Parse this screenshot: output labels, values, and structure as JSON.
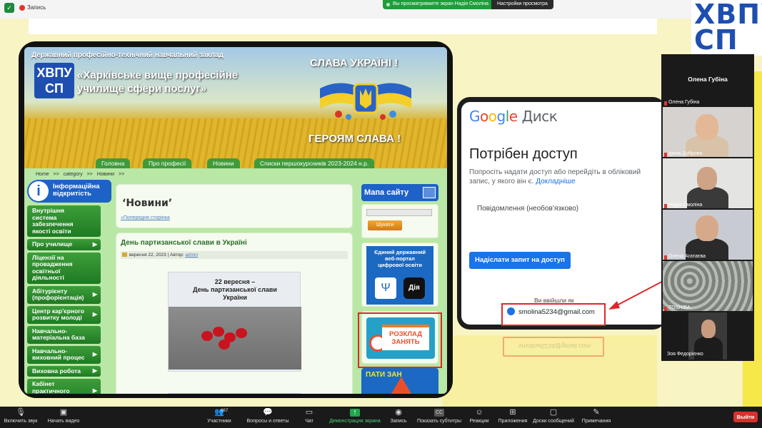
{
  "topbar": {
    "recording_label": "Запись",
    "share_notice": "Вы просматриваете экран Надія Смоліна",
    "view_options": "Настройки просмотра"
  },
  "corner_logo": "ХВПУ\nСП",
  "website": {
    "org_line": "Державний професійно-технічний навчальний заклад",
    "logo_text": "ХВПУ\nСП",
    "school_name": "«Харківське вище професійне\nучилище сфери послуг»",
    "glory_top": "СЛАВА УКРАЇНІ !",
    "glory_bottom": "ГЕРОЯМ СЛАВА !",
    "nav": [
      "Головна",
      "Про професії",
      "Новини",
      "Списки першокурсників 2023-2024 н.р."
    ],
    "breadcrumbs": [
      "Home",
      ">>",
      "category",
      ">>",
      "Новини",
      ">>"
    ],
    "info_box": "Інформаційна\nвідкритість",
    "menu": [
      {
        "label": "Внутрішня система забезпечення якості освіти",
        "arrow": ""
      },
      {
        "label": "Про училище",
        "arrow": "▶"
      },
      {
        "label": "Ліцензії на провадження освітньої діяльності",
        "arrow": ""
      },
      {
        "label": "Абітурієнту (профорієнтація)",
        "arrow": "▶"
      },
      {
        "label": "Центр кар'єрного розвитку молоді",
        "arrow": "▶"
      },
      {
        "label": "Навчально-матеріальна база",
        "arrow": ""
      },
      {
        "label": "Навчально-виховний процес",
        "arrow": "▶"
      },
      {
        "label": "Виховна робота",
        "arrow": "▶"
      },
      {
        "label": "Кабінет практичного психолога",
        "arrow": "▶"
      }
    ],
    "page_heading": "‘Новини’",
    "prev_page": "«Попередня сторінка",
    "post": {
      "title": "День партизанської слави в Україні",
      "date": "вересня 22, 2023",
      "author_prefix": " | Автор: ",
      "author": "admin",
      "image_caption": "22 вересня –\nДень партизанської слави\nУкраїни"
    },
    "sitemap": "Мапа сайту",
    "search_button": "Шукати",
    "portal": {
      "text": "Єдиний державний\nвеб-портал\nцифрової освіти",
      "diia": "Дія"
    },
    "schedule": "РОЗКЛАД\nЗАНЯТЬ",
    "warning_banner": "ПАТИ ЗАН"
  },
  "google_drive": {
    "logo_letters": [
      "G",
      "o",
      "o",
      "g",
      "l",
      "e"
    ],
    "logo_product": "Диск",
    "heading": "Потрібен доступ",
    "desc": "Попросіть надати доступ або перейдіть в обліковий запис, у якого він є. ",
    "desc_link": "Докладніше",
    "message_placeholder": "Повідомлення (необов’язково)",
    "request_button": "Надіслати запит на доступ",
    "signed_in_as": "Ви ввійшли як",
    "email": "smolina5234@gmail.com"
  },
  "participants": {
    "speaker": "Олена Губіна",
    "tiles": [
      {
        "name": "Олена Губіна",
        "bg": "#2b2b2b"
      },
      {
        "name": "Ірина Дуброва",
        "bg": "#d5d2cf"
      },
      {
        "name": "Надія Смоліна",
        "bg": "#e4e4e2"
      },
      {
        "name": "Олена Агатаєва",
        "bg": "#c8ccd2"
      },
      {
        "name": "TOSHIBA",
        "bg": "#9aa09a"
      },
      {
        "name": "Зоя Федорієнко",
        "bg": "#3a3a3a"
      }
    ]
  },
  "controls": [
    {
      "label": "Включить звук",
      "icon": "microphone-muted-icon",
      "glyph": "🎙"
    },
    {
      "label": "Начать видео",
      "icon": "video-off-icon",
      "glyph": "▣"
    },
    {
      "label": "Участники",
      "icon": "participants-icon",
      "glyph": "👥",
      "count": "467"
    },
    {
      "label": "Вопросы и ответы",
      "icon": "qa-icon",
      "glyph": "💬"
    },
    {
      "label": "Чат",
      "icon": "chat-icon",
      "glyph": "▭"
    },
    {
      "label": "Демонстрация экрана",
      "icon": "share-screen-icon",
      "glyph": "↑"
    },
    {
      "label": "Запись",
      "icon": "record-icon",
      "glyph": "◉"
    },
    {
      "label": "Показать субтитры",
      "icon": "captions-icon",
      "glyph": "CC"
    },
    {
      "label": "Реакции",
      "icon": "reactions-icon",
      "glyph": "☺"
    },
    {
      "label": "Приложения",
      "icon": "apps-icon",
      "glyph": "⊞"
    },
    {
      "label": "Доски сообщений",
      "icon": "whiteboard-icon",
      "glyph": "▢"
    },
    {
      "label": "Примечания",
      "icon": "notes-icon",
      "glyph": "✎"
    }
  ],
  "leave_button": "Выйти",
  "colors": {
    "accent_green": "#1fa64a",
    "leave_red": "#d9302c",
    "highlight_red": "#e0262b",
    "site_green": "#3f9b3a"
  }
}
